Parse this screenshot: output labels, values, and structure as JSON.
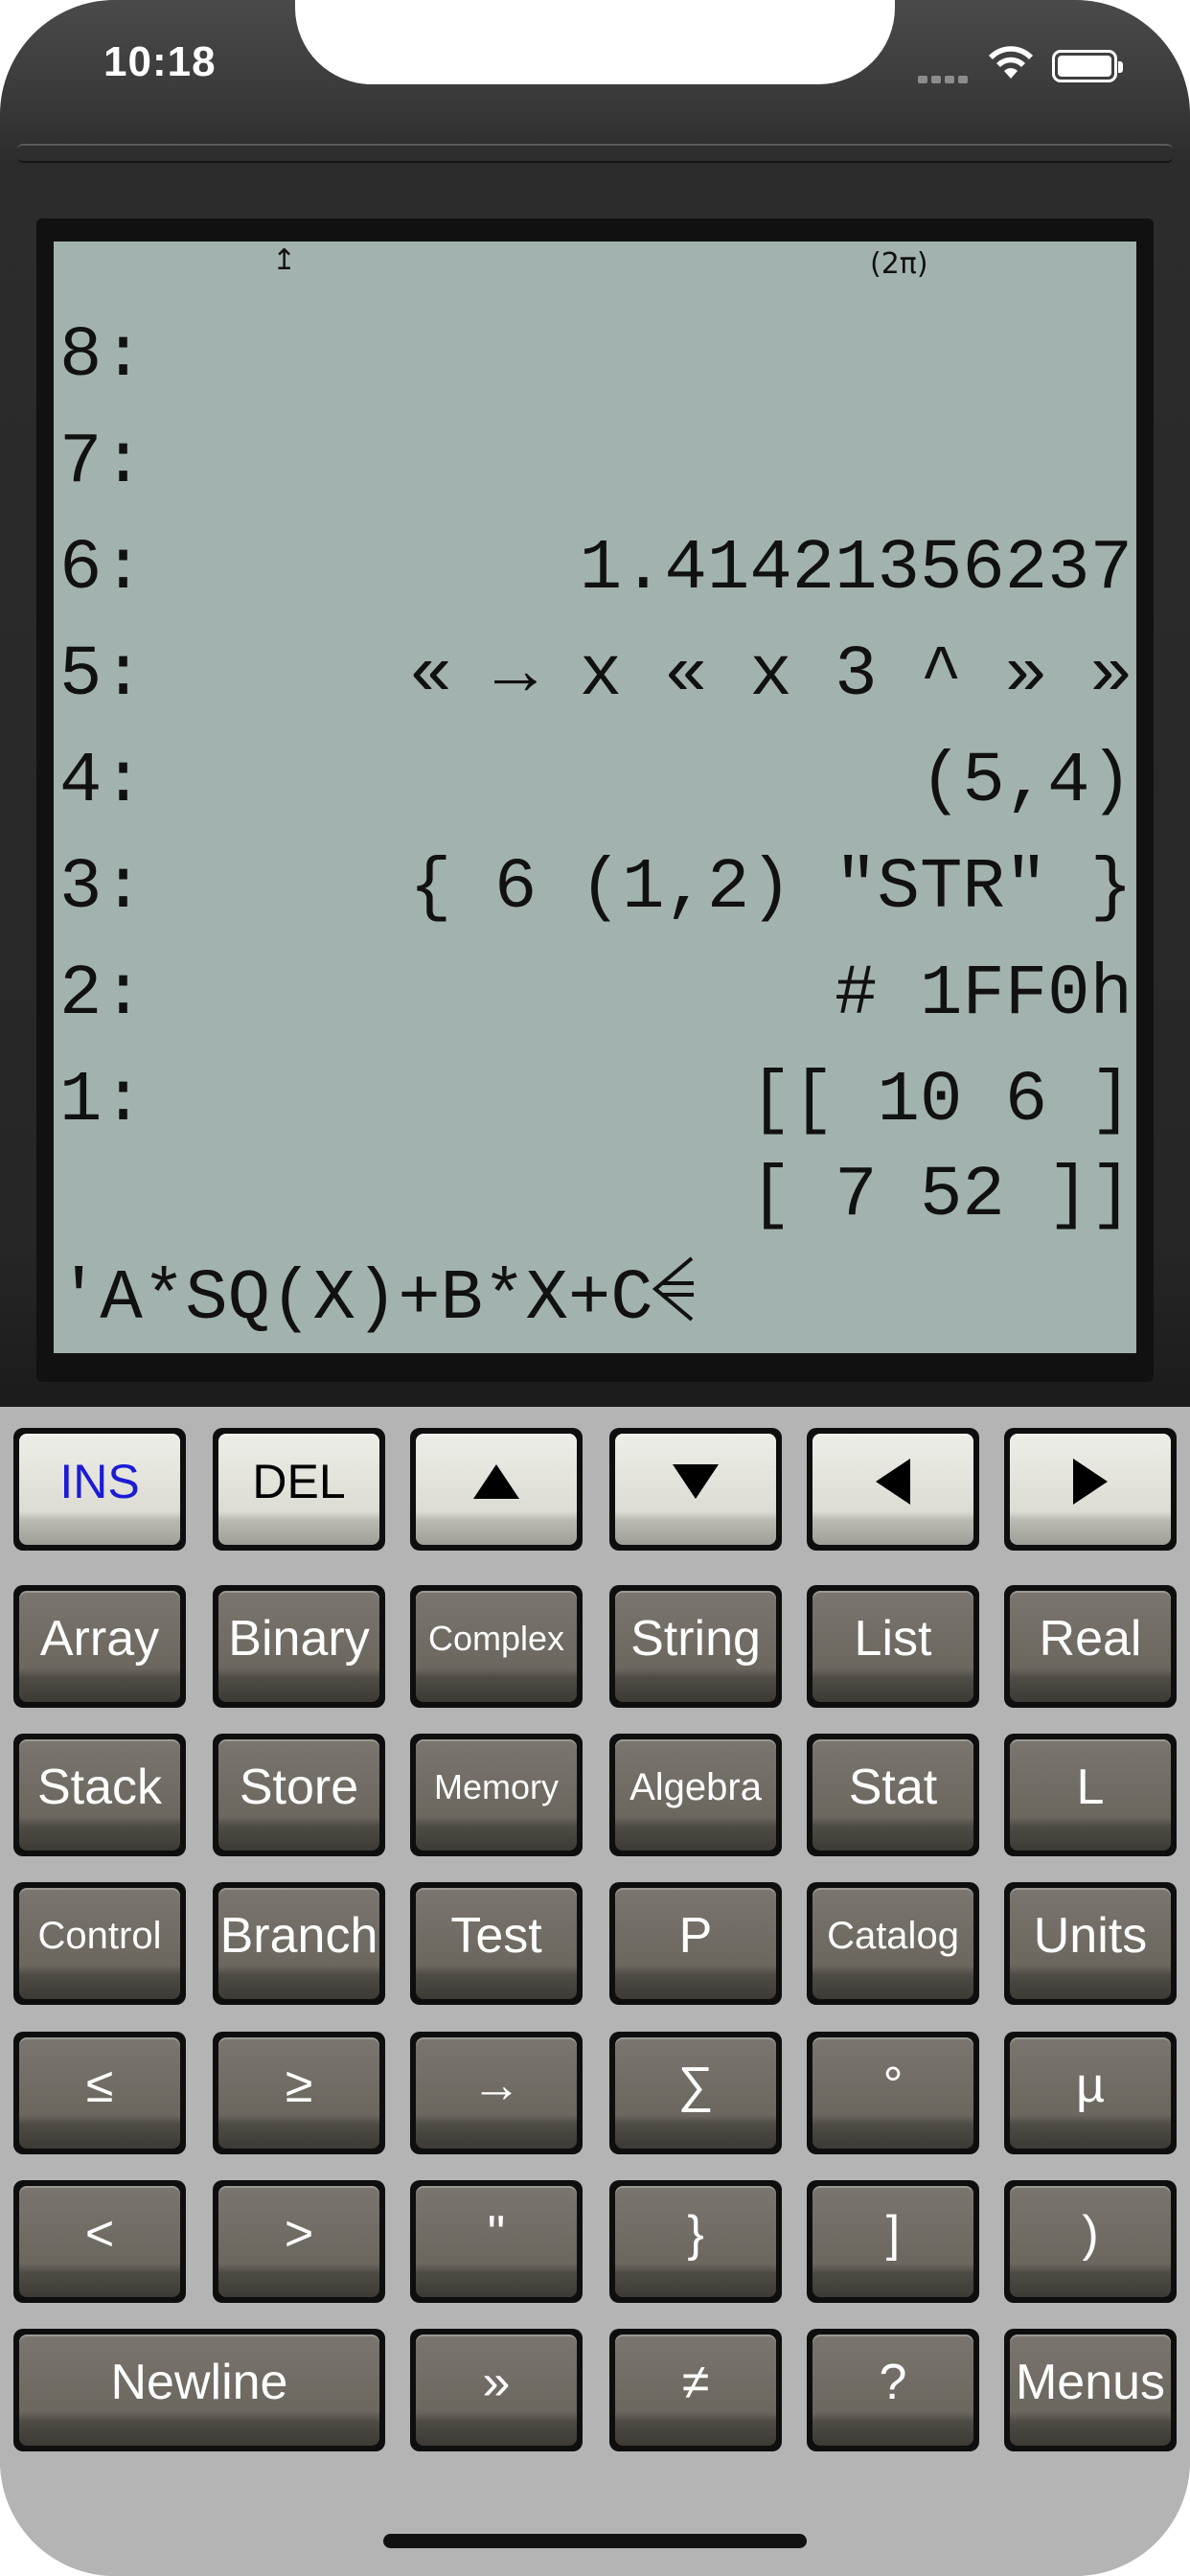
{
  "status_bar": {
    "time": "10:18"
  },
  "lcd": {
    "annunciators": {
      "shift": "↥",
      "angle_mode": "(2π)"
    },
    "stack": [
      {
        "level": "8:",
        "value": ""
      },
      {
        "level": "7:",
        "value": ""
      },
      {
        "level": "6:",
        "value": "1.41421356237"
      },
      {
        "level": "5:",
        "value": "« → x « x 3 ^ » »"
      },
      {
        "level": "4:",
        "value": "(5,4)"
      },
      {
        "level": "3:",
        "value": "{ 6 (1,2) \"STR\" }"
      },
      {
        "level": "2:",
        "value": "# 1FF0h"
      },
      {
        "level": "1:",
        "value": "[[ 10 6 ]"
      },
      {
        "level": "",
        "value": "[ 7 52 ]]"
      }
    ],
    "edit_line": "'A*SQ(X)+B*X+C"
  },
  "keyboard": {
    "edit_keys": {
      "ins": "INS",
      "del": "DEL",
      "up": "up-arrow-icon",
      "down": "down-arrow-icon",
      "left": "left-arrow-icon",
      "right": "right-arrow-icon"
    },
    "rows": [
      [
        "Array",
        "Binary",
        "Complex",
        "String",
        "List",
        "Real"
      ],
      [
        "Stack",
        "Store",
        "Memory",
        "Algebra",
        "Stat",
        "L"
      ],
      [
        "Control",
        "Branch",
        "Test",
        "P",
        "Catalog",
        "Units"
      ],
      [
        "≤",
        "≥",
        "→",
        "∑",
        "°",
        "µ"
      ],
      [
        "<",
        ">",
        "\"",
        "}",
        "]",
        ")"
      ]
    ],
    "bottom_row": {
      "newline": "Newline",
      "k2": "»",
      "k3": "≠",
      "k4": "?",
      "menus": "Menus"
    }
  },
  "colors": {
    "lcd": "#a2b2af",
    "bezel": "#262626",
    "keyboard": "#b4b4b4",
    "ins_label": "#1b1bd6"
  }
}
